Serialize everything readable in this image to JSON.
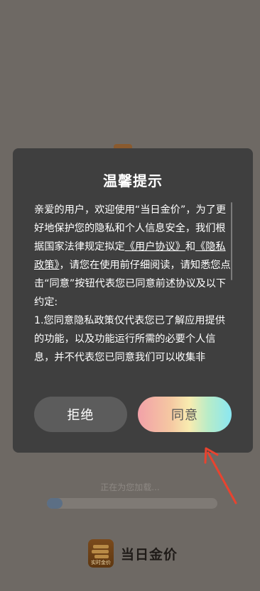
{
  "dialog": {
    "title": "温馨提示",
    "body": {
      "intro": "亲爱的用户，欢迎使用“当日金价”，为了更好地保护您的隐私和个人信息安全，我们根据国家法律规定拟定",
      "user_agreement_link": "《用户协议》",
      "and_text": "和",
      "privacy_policy_link": "《隐私政策》",
      "instruction": "，请您在使用前仔细阅读，请知悉您点击“同意”按钮代表您已同意前述协议及以下约定:",
      "clause_1": "1.您同意隐私政策仅代表您已了解应用提供的功能，以及功能运行所需的必要个人信息，并不代表您已同意我们可以收集非"
    },
    "refuse_label": "拒绝",
    "agree_label": "同意"
  },
  "splash": {
    "loading_text": "正在为您加载...",
    "progress_fraction": 0.09,
    "app_name": "当日金价",
    "logo_caption": "实时金价"
  },
  "colors": {
    "overlay_bg": "#6e6964",
    "dialog_bg": "#3f3f3f",
    "refuse_bg": "#5c5c5c",
    "annotation_arrow": "#e8432f"
  },
  "annotations": {
    "arrow_icon": "red-arrow-icon"
  }
}
